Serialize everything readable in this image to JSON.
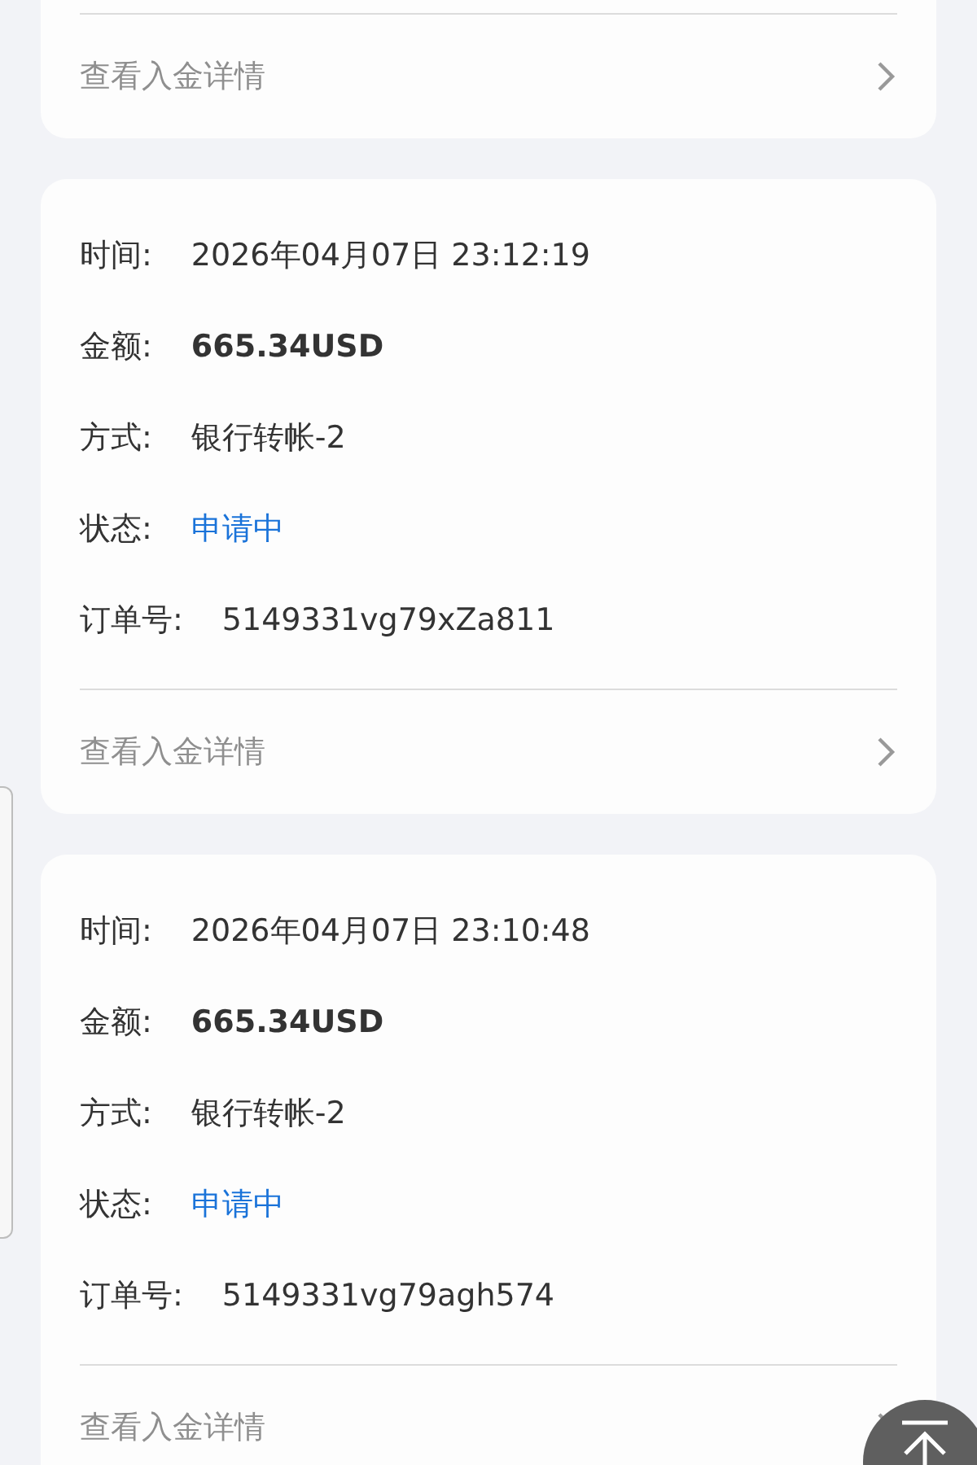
{
  "records": [
    {
      "detail_link": "查看入金详情"
    },
    {
      "fields": [
        {
          "label": "时间:",
          "value": "2026年04月07日 23:12:19",
          "kind": "text"
        },
        {
          "label": "金额:",
          "value": "665.34USD",
          "kind": "amount"
        },
        {
          "label": "方式:",
          "value": "银行转帐-2",
          "kind": "text"
        },
        {
          "label": "状态:",
          "value": "申请中",
          "kind": "status"
        },
        {
          "label": "订单号:",
          "value": "5149331vg79xZa811",
          "kind": "text"
        }
      ],
      "detail_link": "查看入金详情"
    },
    {
      "fields": [
        {
          "label": "时间:",
          "value": "2026年04月07日 23:10:48",
          "kind": "text"
        },
        {
          "label": "金额:",
          "value": "665.34USD",
          "kind": "amount"
        },
        {
          "label": "方式:",
          "value": "银行转帐-2",
          "kind": "text"
        },
        {
          "label": "状态:",
          "value": "申请中",
          "kind": "status"
        },
        {
          "label": "订单号:",
          "value": "5149331vg79agh574",
          "kind": "text"
        }
      ],
      "detail_link": "查看入金详情"
    }
  ]
}
